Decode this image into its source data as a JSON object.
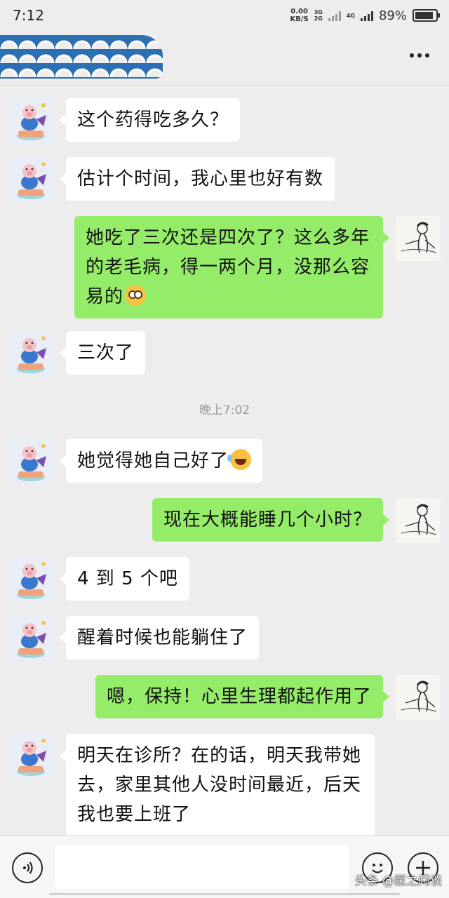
{
  "status_bar": {
    "time": "7:12",
    "net_speed": "0.00",
    "net_unit": "KB/S",
    "net_tag_top": "3G",
    "net_tag_bottom": "2G",
    "net_tag_4g": "4G",
    "battery": "89%",
    "battery_level": 0.89
  },
  "header": {
    "contact_name_redacted": true,
    "more_icon": "more-dots-icon"
  },
  "messages": [
    {
      "side": "left",
      "avatar": "pig-avatar",
      "text": "这个药得吃多久？"
    },
    {
      "side": "left",
      "avatar": "pig-avatar",
      "text": "估计个时间，我心里也好有数"
    },
    {
      "side": "right",
      "avatar": "sage-avatar",
      "lines": [
        "她吃了三次还是四次了？这么多年",
        "的老毛病，得一两个月，没那么容",
        "易的"
      ],
      "emoji": "flushed-face"
    },
    {
      "side": "left",
      "avatar": "pig-avatar",
      "text": "三次了"
    },
    {
      "side": "left",
      "avatar": "pig-avatar",
      "text": "她觉得她自己好了",
      "emoji": "laughing-tears"
    },
    {
      "side": "right",
      "avatar": "sage-avatar",
      "text": "现在大概能睡几个小时？"
    },
    {
      "side": "left",
      "avatar": "pig-avatar",
      "text": "4 到 5 个吧"
    },
    {
      "side": "left",
      "avatar": "pig-avatar",
      "text": "醒着时候也能躺住了"
    },
    {
      "side": "right",
      "avatar": "sage-avatar",
      "text": "嗯，保持！心里生理都起作用了"
    },
    {
      "side": "left",
      "avatar": "pig-avatar",
      "lines": [
        "明天在诊所？在的话，明天我带她",
        "去，家里其他人没时间最近，后天",
        "我也要上班了"
      ]
    }
  ],
  "timestamp": "晚上7:02",
  "input_bar": {
    "voice_icon": "voice-icon",
    "emoji_icon": "emoji-icon",
    "plus_icon": "plus-icon",
    "input_value": ""
  },
  "watermark": "头条 @医之闲谈"
}
